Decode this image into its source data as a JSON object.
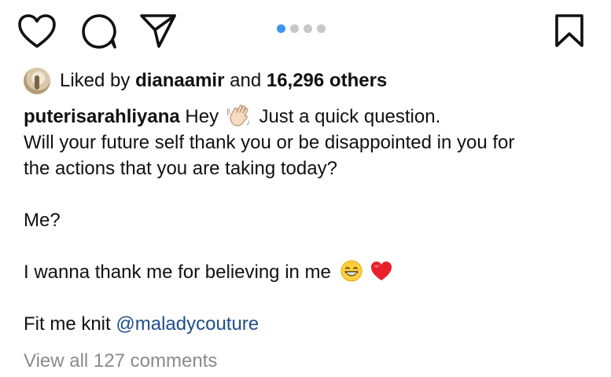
{
  "actions": {
    "like_icon": "heart-icon",
    "comment_icon": "comment-icon",
    "share_icon": "send-icon",
    "save_icon": "bookmark-icon"
  },
  "pager": {
    "total": 4,
    "active": 1,
    "active_color": "#3f95f0",
    "inactive_color": "#c7c7c7"
  },
  "likes": {
    "prefix": "Liked by",
    "user": "dianaamir",
    "connector": "and",
    "others": "16,296 others"
  },
  "caption": {
    "username": "puterisarahliyana",
    "line1_before_emoji": "Hey",
    "line1_emoji": "waving-hand-emoji",
    "line1_after_emoji": "Just a quick question.",
    "line2": "Will your future self thank you or be disappointed in you for",
    "line3": "the actions that you are taking today?",
    "line4": "Me?",
    "line5": "I wanna thank me for believing in me",
    "line5_emojis": [
      "grinning-face-emoji",
      "red-heart-emoji"
    ],
    "line6_prefix": "Fit me knit",
    "mention": "@maladycouture"
  },
  "comments": {
    "label": "View all 127 comments"
  },
  "colors": {
    "text": "#111111",
    "muted": "#8a8a8a",
    "mention": "#1f4e8c"
  }
}
